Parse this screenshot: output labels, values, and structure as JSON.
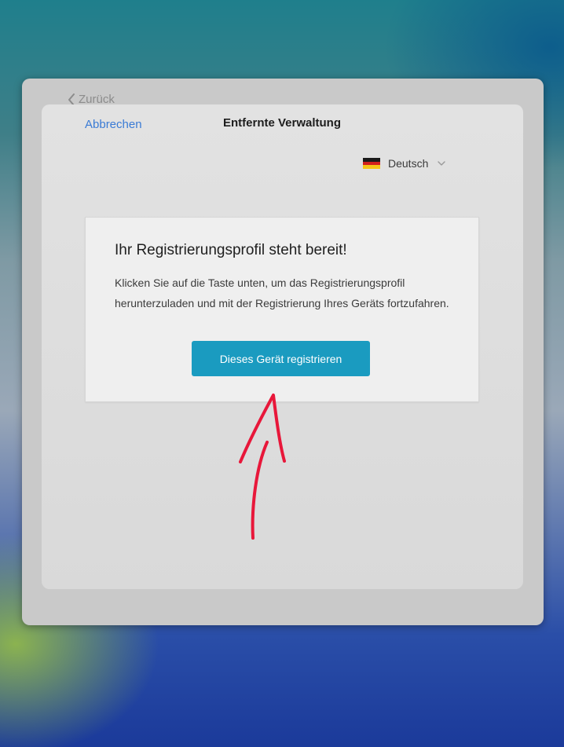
{
  "nav": {
    "back_label": "Zurück",
    "cancel_label": "Abbrechen",
    "title": "Entfernte Verwaltung"
  },
  "language": {
    "selected": "Deutsch",
    "flag": "flag-de-icon"
  },
  "card": {
    "title": "Ihr Registrierungsprofil steht bereit!",
    "body": "Klicken Sie auf die Taste unten, um das Registrierungsprofil herunterzuladen und mit der Registrierung Ihres Geräts fortzufahren.",
    "button_label": "Dieses Gerät registrieren"
  },
  "colors": {
    "accent_link": "#3a7bd5",
    "button": "#1a9bc0",
    "annotation_arrow": "#e8173a"
  }
}
